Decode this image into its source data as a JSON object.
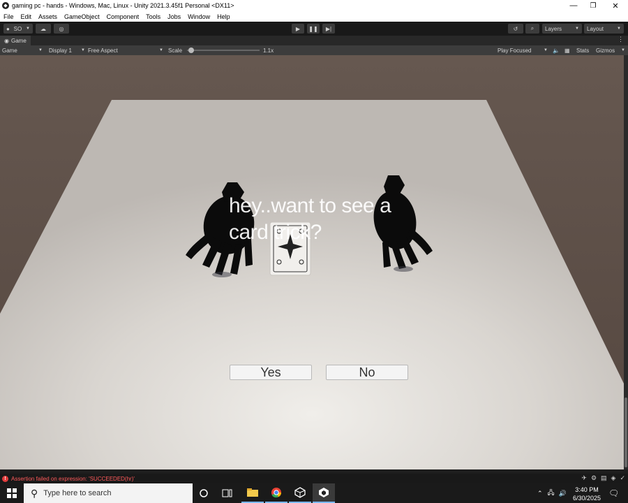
{
  "window": {
    "title": "gaming pc - hands - Windows, Mac, Linux - Unity 2021.3.45f1 Personal <DX11>",
    "minimize": "—",
    "maximize": "❐",
    "close": "✕"
  },
  "menu": [
    "File",
    "Edit",
    "Assets",
    "GameObject",
    "Component",
    "Tools",
    "Jobs",
    "Window",
    "Help"
  ],
  "toolbar": {
    "account": "SO",
    "layers": "Layers",
    "layout": "Layout"
  },
  "game_tab": {
    "label": "Game"
  },
  "game_controls": {
    "mode": "Game",
    "display": "Display 1",
    "aspect": "Free Aspect",
    "scale_label": "Scale",
    "scale_value": "1.1x",
    "play_mode": "Play Focused",
    "stats": "Stats",
    "gizmos": "Gizmos"
  },
  "game": {
    "dialog": "hey..want to see a card trick?",
    "yes": "Yes",
    "no": "No"
  },
  "console": {
    "message": "Assertion failed on expression: 'SUCCEEDED(hr)'"
  },
  "taskbar": {
    "search_placeholder": "Type here to search",
    "time": "3:40 PM",
    "date": "6/30/2025"
  },
  "colors": {
    "error": "#ff5a5a",
    "unity_dark": "#3c3c3c"
  }
}
